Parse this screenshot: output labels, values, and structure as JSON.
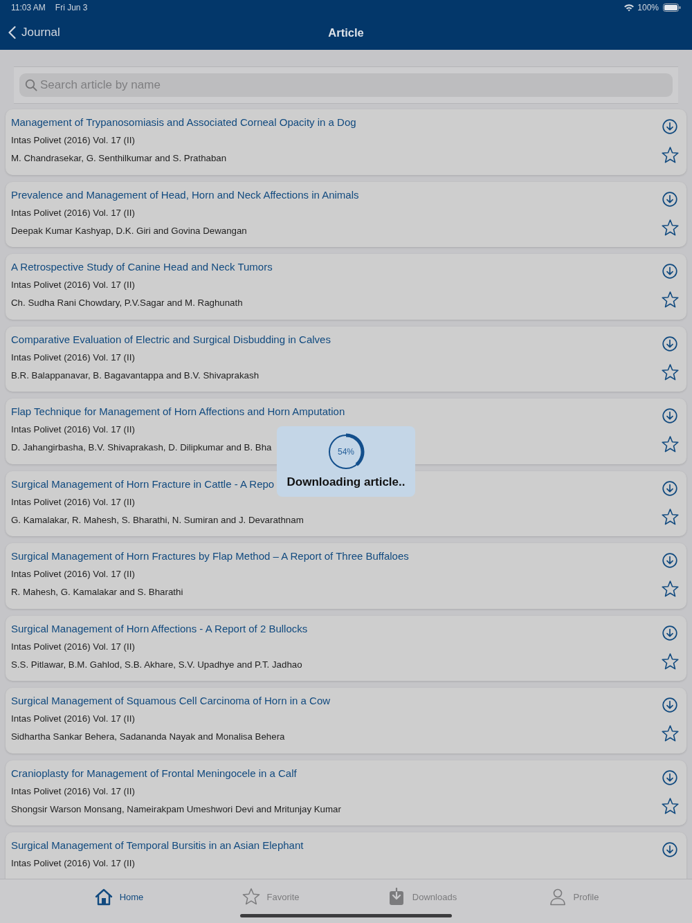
{
  "status_bar": {
    "time": "11:03 AM",
    "date": "Fri Jun 3",
    "battery": "100%"
  },
  "nav_bar": {
    "back_label": "Journal",
    "title": "Article"
  },
  "search": {
    "placeholder": "Search article by name"
  },
  "articles": [
    {
      "title": "Management of Trypanosomiasis and Associated Corneal Opacity in a Dog",
      "journal": "Intas Polivet (2016) Vol. 17 (II)",
      "authors": "M. Chandrasekar, G. Senthilkumar and S. Prathaban",
      "favorite": false
    },
    {
      "title": "Prevalence and Management of Head, Horn and Neck Affections in Animals",
      "journal": "Intas Polivet (2016) Vol. 17 (II)",
      "authors": "Deepak Kumar Kashyap, D.K. Giri and Govina Dewangan",
      "favorite": false
    },
    {
      "title": "A Retrospective Study of Canine Head and Neck Tumors",
      "journal": "Intas Polivet (2016) Vol. 17 (II)",
      "authors": "Ch. Sudha Rani Chowdary, P.V.Sagar and M. Raghunath",
      "favorite": false
    },
    {
      "title": "Comparative Evaluation of Electric and Surgical Disbudding in Calves",
      "journal": "Intas Polivet (2016) Vol. 17 (II)",
      "authors": "B.R. Balappanavar, B. Bagavantappa and B.V. Shivaprakash",
      "favorite": false
    },
    {
      "title": "Flap Technique for Management of Horn Affections and Horn Amputation",
      "journal": "Intas Polivet (2016) Vol. 17 (II)",
      "authors": "D. Jahangirbasha, B.V. Shivaprakash, D. Dilipkumar and B. Bha",
      "favorite": false
    },
    {
      "title": "Surgical Management of Horn Fracture in Cattle - A Repo",
      "journal": "Intas Polivet (2016) Vol. 17 (II)",
      "authors": "G. Kamalakar, R. Mahesh, S. Bharathi, N. Sumiran and J. Devarathnam",
      "favorite": false
    },
    {
      "title": "Surgical Management of Horn Fractures by Flap Method – A Report of Three Buffaloes",
      "journal": "Intas Polivet (2016) Vol. 17 (II)",
      "authors": "R. Mahesh, G. Kamalakar and S. Bharathi",
      "favorite": false
    },
    {
      "title": "Surgical Management of Horn Affections - A Report of 2 Bullocks",
      "journal": "Intas Polivet (2016) Vol. 17 (II)",
      "authors": "S.S. Pitlawar, B.M. Gahlod, S.B. Akhare, S.V. Upadhye and P.T. Jadhao",
      "favorite": false
    },
    {
      "title": "Surgical Management of Squamous Cell Carcinoma of Horn in a Cow",
      "journal": "Intas Polivet (2016) Vol. 17 (II)",
      "authors": "Sidhartha Sankar Behera, Sadananda Nayak and Monalisa Behera",
      "favorite": false
    },
    {
      "title": "Cranioplasty for Management of Frontal Meningocele in a Calf",
      "journal": "Intas Polivet (2016) Vol. 17 (II)",
      "authors": "Shongsir Warson Monsang, Nameirakpam Umeshwori Devi and Mritunjay Kumar",
      "favorite": false
    },
    {
      "title": "Surgical Management of Temporal Bursitis in an Asian Elephant",
      "journal": "Intas Polivet (2016) Vol. 17 (II)"
    }
  ],
  "download_popup": {
    "level": 0.39,
    "reading": "54%",
    "message": "Downloading article.."
  },
  "tab_bar": [
    {
      "kind": "home",
      "label": "Home",
      "selected": true
    },
    {
      "kind": "favorite",
      "label": "Favorite",
      "selected": false
    },
    {
      "kind": "downloads",
      "label": "Downloads",
      "selected": false
    },
    {
      "kind": "profile",
      "label": "Profile",
      "selected": false
    }
  ]
}
